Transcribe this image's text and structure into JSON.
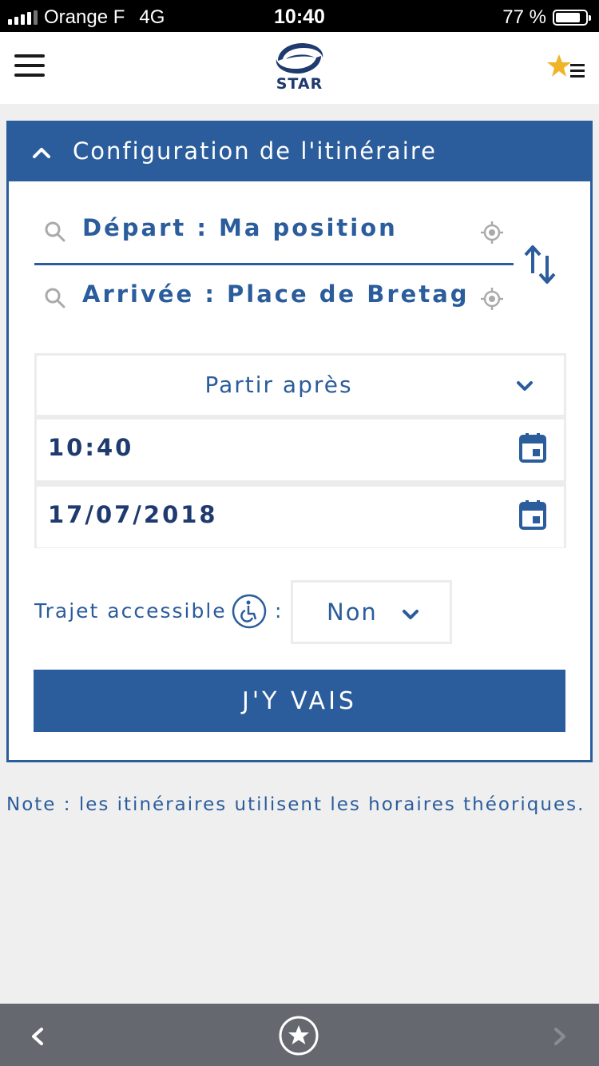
{
  "status_bar": {
    "carrier": "Orange F",
    "network": "4G",
    "time": "10:40",
    "battery": "77 %",
    "battery_level": 0.77
  },
  "header": {
    "logo_text": "STAR",
    "menu_icon": "hamburger-icon",
    "favorites_icon": "star-list-icon"
  },
  "itinerary": {
    "title": "Configuration de l'itinéraire",
    "departure": "Départ : Ma position",
    "arrival": "Arrivée : Place de Bretagne",
    "mode_select": "Partir après",
    "time": "10:40",
    "date": "17/07/2018",
    "accessible_label": "Trajet accessible",
    "accessible_colon": ":",
    "accessible_value": "Non",
    "submit_label": "J'Y VAIS"
  },
  "note": "Note : les itinéraires utilisent les horaires théoriques.",
  "colors": {
    "primary": "#2b5c9c",
    "dark_blue": "#1e3a6e",
    "background": "#efefef",
    "bottom_bar": "#666870",
    "star": "#f0b429"
  },
  "bottom_nav": {
    "back_icon": "chevron-left-icon",
    "favorite_icon": "star-circle-icon",
    "forward_icon": "chevron-right-icon"
  }
}
